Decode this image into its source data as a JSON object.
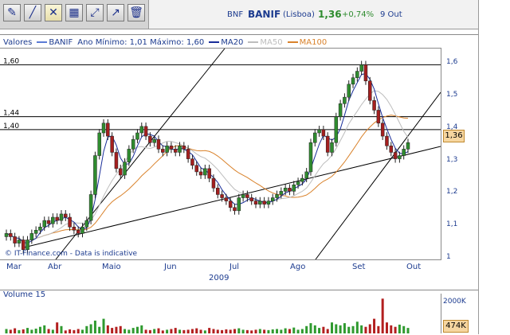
{
  "toolbar": {
    "buttons": [
      {
        "name": "draw-tool",
        "icon": "pencil-icon"
      },
      {
        "name": "line-tool",
        "icon": "diagonal-line-icon"
      },
      {
        "name": "crosshair-tool",
        "icon": "crosshair-icon"
      },
      {
        "name": "indicators-tool",
        "icon": "chart-grid-icon"
      },
      {
        "name": "trend-tool",
        "icon": "trend-arrow-icon"
      },
      {
        "name": "zoom-tool",
        "icon": "diagonal-arrow-icon"
      },
      {
        "name": "delete-tool",
        "icon": "trash-icon"
      }
    ]
  },
  "ticker": {
    "symbol": "BNF",
    "name": "BANIF",
    "exchange": "(Lisboa)",
    "price": "1,36",
    "change": "+0,74%",
    "date": "9 Out"
  },
  "legend": {
    "values_label": "Valores",
    "series_label": "BANIF",
    "range_label": "Ano Mínimo: 1,01 Máximo: 1,60",
    "ma20_label": "MA20",
    "ma50_label": "MA50",
    "ma100_label": "MA100"
  },
  "colors": {
    "candle_up": "#2f8c2f",
    "candle_down": "#a41f1f",
    "ma20": "#1a2e9a",
    "ma50": "#bdbdbd",
    "ma100": "#d9822b",
    "volume_up": "#2f9a2f",
    "volume_down": "#b31f1f",
    "text": "#1c3b8f"
  },
  "price_axis": {
    "ticks": [
      "1,6",
      "1,5",
      "1,4",
      "1,3",
      "1,2",
      "1,1",
      "1"
    ],
    "current": "1,36"
  },
  "horizontal_levels": [
    "1,60",
    "1,44",
    "1,40"
  ],
  "time_axis": {
    "months": [
      "Mar",
      "Abr",
      "Maio",
      "Jun",
      "Jul",
      "Ago",
      "Set",
      "Out"
    ],
    "year": "2009"
  },
  "watermark": "© IT-Finance.com - Data is indicative",
  "volume": {
    "title": "Volume 15",
    "axis_top": "2000K",
    "current": "474K"
  },
  "chart_data": {
    "type": "candlestick",
    "ylim": [
      1.0,
      1.65
    ],
    "closes": [
      1.08,
      1.07,
      1.05,
      1.06,
      1.03,
      1.06,
      1.08,
      1.09,
      1.1,
      1.12,
      1.11,
      1.13,
      1.12,
      1.14,
      1.13,
      1.1,
      1.09,
      1.08,
      1.1,
      1.12,
      1.2,
      1.32,
      1.39,
      1.42,
      1.38,
      1.33,
      1.28,
      1.26,
      1.3,
      1.34,
      1.37,
      1.39,
      1.41,
      1.38,
      1.36,
      1.37,
      1.34,
      1.33,
      1.35,
      1.34,
      1.33,
      1.35,
      1.34,
      1.31,
      1.29,
      1.27,
      1.26,
      1.28,
      1.25,
      1.22,
      1.2,
      1.19,
      1.18,
      1.16,
      1.15,
      1.19,
      1.2,
      1.19,
      1.18,
      1.17,
      1.18,
      1.17,
      1.18,
      1.19,
      1.2,
      1.21,
      1.22,
      1.21,
      1.23,
      1.24,
      1.25,
      1.27,
      1.36,
      1.39,
      1.4,
      1.38,
      1.33,
      1.36,
      1.44,
      1.48,
      1.5,
      1.54,
      1.56,
      1.58,
      1.6,
      1.55,
      1.49,
      1.46,
      1.42,
      1.38,
      1.35,
      1.33,
      1.31,
      1.32,
      1.34,
      1.36
    ],
    "volumes": [
      0.12,
      0.1,
      0.14,
      0.09,
      0.11,
      0.15,
      0.1,
      0.13,
      0.18,
      0.22,
      0.12,
      0.1,
      0.3,
      0.2,
      0.08,
      0.11,
      0.09,
      0.12,
      0.1,
      0.2,
      0.25,
      0.35,
      0.18,
      0.4,
      0.22,
      0.15,
      0.18,
      0.2,
      0.12,
      0.1,
      0.15,
      0.18,
      0.22,
      0.1,
      0.09,
      0.12,
      0.14,
      0.08,
      0.1,
      0.12,
      0.15,
      0.1,
      0.09,
      0.1,
      0.12,
      0.14,
      0.1,
      0.08,
      0.15,
      0.12,
      0.1,
      0.09,
      0.11,
      0.1,
      0.12,
      0.14,
      0.1,
      0.09,
      0.08,
      0.1,
      0.12,
      0.1,
      0.09,
      0.11,
      0.12,
      0.1,
      0.14,
      0.12,
      0.16,
      0.1,
      0.12,
      0.2,
      0.28,
      0.22,
      0.15,
      0.18,
      0.12,
      0.3,
      0.25,
      0.22,
      0.28,
      0.18,
      0.2,
      0.32,
      0.22,
      0.18,
      0.25,
      0.4,
      0.2,
      0.95,
      0.3,
      0.22,
      0.18,
      0.24,
      0.2,
      0.15
    ]
  }
}
